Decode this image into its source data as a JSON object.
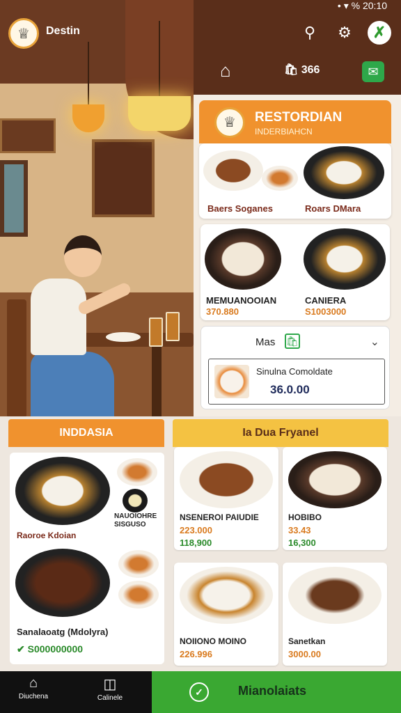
{
  "status": {
    "text": "• ▾ % 20:10"
  },
  "header": {
    "brand": "Destin",
    "order_count": "🛍 366"
  },
  "restaurant": {
    "title": "RESTORDIAN",
    "subtitle": "INDERBIAHCN"
  },
  "top_cards": [
    {
      "name": "Baers Soganes",
      "name2": "Roars DMara"
    },
    {
      "name": "MEMUANOOIAN",
      "price": "370.880",
      "name2": "CANIERA",
      "price2": "S1003000"
    }
  ],
  "mas": {
    "label": "Mas",
    "item_name": "Sinulna Comoldate",
    "item_price": "36.0.00"
  },
  "left_section": {
    "title": "INDDASIA",
    "item1_name": "Raoroe Kdoian",
    "side_label": "NAUOIOHRE SISGUSO",
    "item2_name": "Sanalaoatg (Mdolyra)",
    "item2_price": "S000000000"
  },
  "right_section": {
    "title": "Ia Dua Fryanel",
    "tiles": [
      {
        "name": "NSENEROI PAIUDIE",
        "price": "223.000",
        "price2": "118,900"
      },
      {
        "name": "HOBIBO",
        "price": "33.43",
        "price2": "16,300"
      },
      {
        "name": "NOIIONO MOINO",
        "price": "226.996"
      },
      {
        "name": "Sanetkan",
        "price": "3000.00"
      }
    ]
  },
  "nav": {
    "item1": "Diuchena",
    "item2": "Calinele",
    "cta": "Mianolaiats"
  }
}
